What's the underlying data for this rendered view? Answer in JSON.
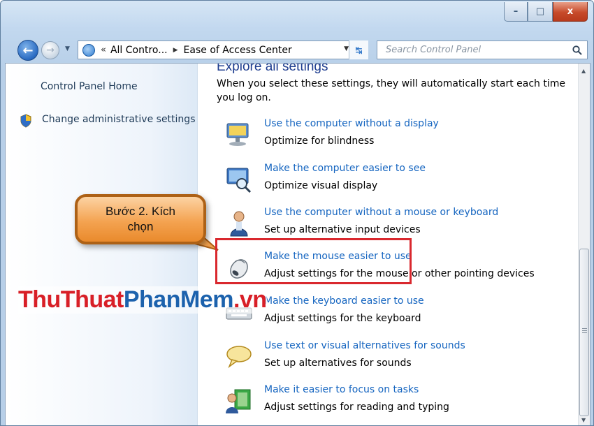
{
  "window": {
    "controls": {
      "minimize": "–",
      "maximize": "□",
      "close": "x"
    }
  },
  "navbar": {
    "back_icon": "back-arrow-icon",
    "forward_icon": "forward-arrow-icon",
    "address": {
      "prefix": "«",
      "crumbs": [
        "All Contro...",
        "Ease of Access Center"
      ]
    },
    "search": {
      "placeholder": "Search Control Panel"
    }
  },
  "leftpane": {
    "home_link": "Control Panel Home",
    "admin_link": "Change administrative settings"
  },
  "main": {
    "section_title": "Explore all settings",
    "section_desc": "When you select these settings, they will automatically start each time you log on.",
    "settings": [
      {
        "icon": "display-icon",
        "link": "Use the computer without a display",
        "desc": "Optimize for blindness"
      },
      {
        "icon": "magnifier-monitor-icon",
        "link": "Make the computer easier to see",
        "desc": "Optimize visual display"
      },
      {
        "icon": "user-icon",
        "link": "Use the computer without a mouse or keyboard",
        "desc": "Set up alternative input devices"
      },
      {
        "icon": "mouse-icon",
        "link": "Make the mouse easier to use",
        "desc": "Adjust settings for the mouse or other pointing devices"
      },
      {
        "icon": "keyboard-icon",
        "link": "Make the keyboard easier to use",
        "desc": "Adjust settings for the keyboard"
      },
      {
        "icon": "speech-bubble-icon",
        "link": "Use text or visual alternatives for sounds",
        "desc": "Set up alternatives for sounds"
      },
      {
        "icon": "focus-tasks-icon",
        "link": "Make it easier to focus on tasks",
        "desc": "Adjust settings for reading and typing"
      }
    ]
  },
  "annotation": {
    "callout_text": "Bước 2. Kích chọn",
    "highlight_color": "#d9282e",
    "callout_color": "#f4a351"
  },
  "watermark": {
    "part1": "ThuThuat",
    "part2": "PhanMem",
    "part3": ".vn"
  }
}
